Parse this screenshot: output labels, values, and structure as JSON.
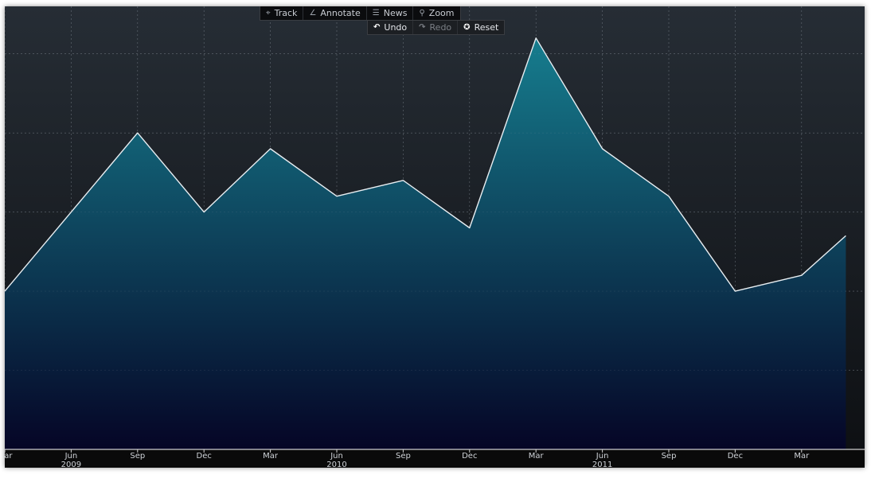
{
  "toolbar": {
    "tools": [
      {
        "label": "Track",
        "icon": "crosshair-icon"
      },
      {
        "label": "Annotate",
        "icon": "pencil-icon"
      },
      {
        "label": "News",
        "icon": "news-icon"
      },
      {
        "label": "Zoom",
        "icon": "magnifier-icon"
      }
    ],
    "actions": [
      {
        "label": "Undo",
        "icon": "undo-icon",
        "enabled": true
      },
      {
        "label": "Redo",
        "icon": "redo-icon",
        "enabled": false
      },
      {
        "label": "Reset",
        "icon": "reset-icon",
        "enabled": true
      }
    ]
  },
  "colors": {
    "background_top": "#262d35",
    "background_bottom": "#0d0f12",
    "area_top": "#167d8e",
    "area_bottom": "#050526",
    "line": "#e8eef2",
    "axis_bar": "#0a0a0a",
    "grid": "#9aa3ad"
  },
  "chart_data": {
    "type": "area",
    "x": [
      "2009-03",
      "2009-06",
      "2009-09",
      "2009-12",
      "2010-03",
      "2010-06",
      "2010-09",
      "2010-12",
      "2011-03",
      "2011-06",
      "2011-09",
      "2011-12",
      "2012-03",
      "2012-05"
    ],
    "values": [
      1.0,
      2.0,
      3.0,
      2.0,
      2.8,
      2.2,
      2.4,
      1.8,
      4.2,
      2.8,
      2.2,
      1.0,
      1.2,
      1.7
    ],
    "ylim": [
      -1.0,
      4.6
    ],
    "y_gridlines": [
      0,
      1,
      2,
      3,
      4
    ],
    "y_tick_labels_visible": false,
    "x_ticks": [
      {
        "label": "Mar",
        "x": "2009-03"
      },
      {
        "label": "Jun",
        "x": "2009-06"
      },
      {
        "label": "Sep",
        "x": "2009-09"
      },
      {
        "label": "Dec",
        "x": "2009-12"
      },
      {
        "label": "Mar",
        "x": "2010-03"
      },
      {
        "label": "Jun",
        "x": "2010-06"
      },
      {
        "label": "Sep",
        "x": "2010-09"
      },
      {
        "label": "Dec",
        "x": "2010-12"
      },
      {
        "label": "Mar",
        "x": "2011-03"
      },
      {
        "label": "Jun",
        "x": "2011-06"
      },
      {
        "label": "Sep",
        "x": "2011-09"
      },
      {
        "label": "Dec",
        "x": "2011-12"
      },
      {
        "label": "Mar",
        "x": "2012-03"
      }
    ],
    "year_labels": [
      {
        "label": "2009",
        "x": "2009-06"
      },
      {
        "label": "2010",
        "x": "2010-06"
      },
      {
        "label": "2011",
        "x": "2011-06"
      }
    ],
    "grid": true,
    "title": "",
    "xlabel": "",
    "ylabel": ""
  }
}
